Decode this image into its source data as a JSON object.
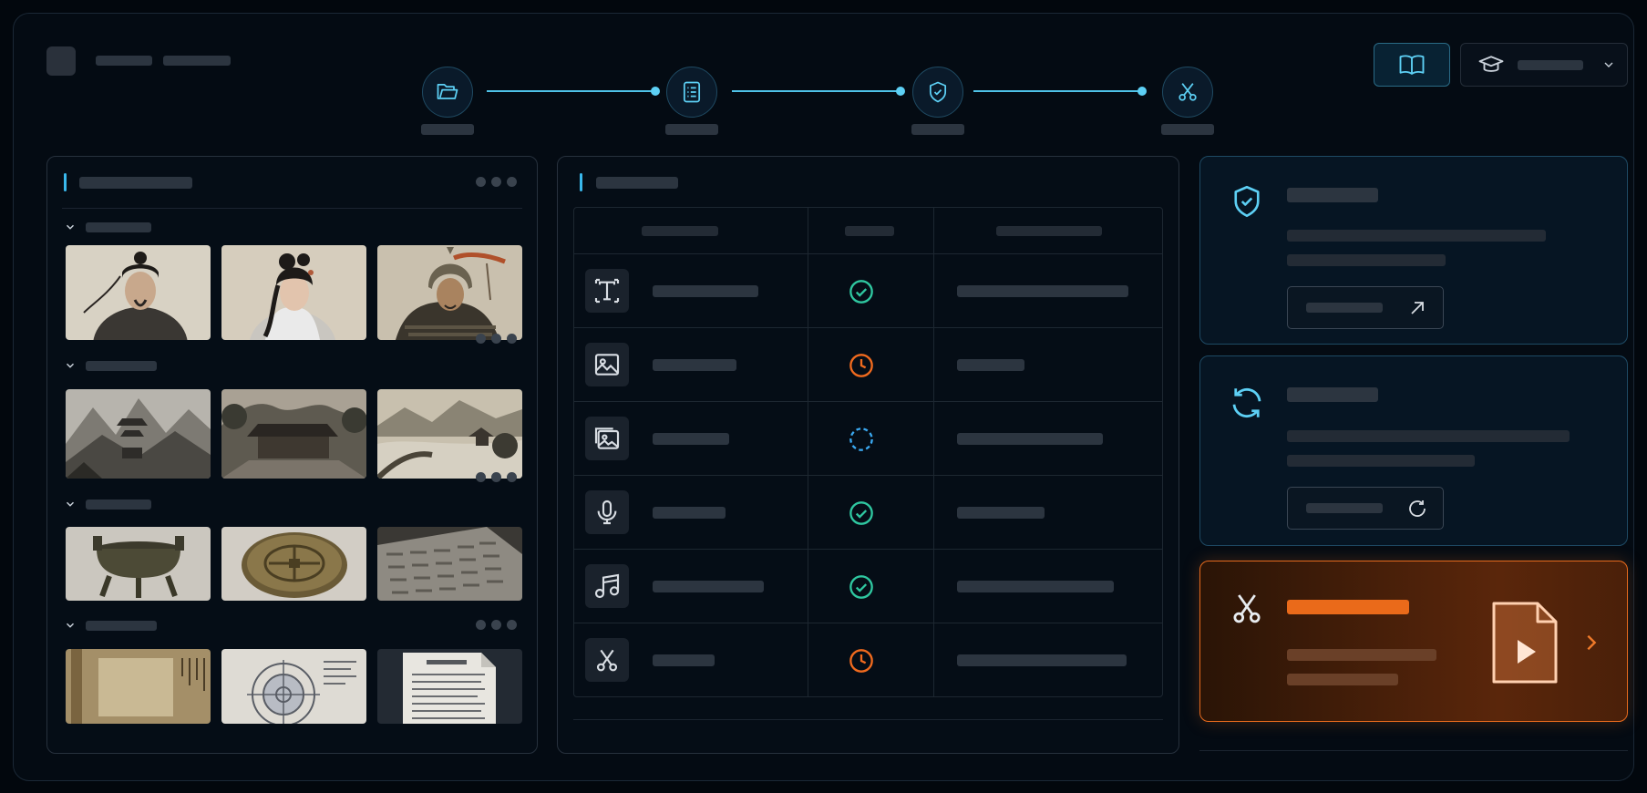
{
  "header": {
    "app_title": "",
    "nav_text_1": "",
    "nav_text_2": ""
  },
  "workflow": {
    "steps": [
      {
        "icon": "folder-open-icon",
        "label": ""
      },
      {
        "icon": "checklist-icon",
        "label": ""
      },
      {
        "icon": "shield-check-icon",
        "label": ""
      },
      {
        "icon": "scissors-icon",
        "label": ""
      }
    ]
  },
  "toolbar": {
    "library_icon": "book-open-icon",
    "profile_icon": "graduation-cap-icon",
    "profile_label": ""
  },
  "assets_panel": {
    "title": "",
    "groups": [
      {
        "label": "",
        "thumbnails": [
          "scholar-portrait",
          "lady-portrait",
          "warrior-portrait"
        ]
      },
      {
        "label": "",
        "thumbnails": [
          "mountain-temple",
          "courtyard-pavilion",
          "river-village"
        ]
      },
      {
        "label": "",
        "thumbnails": [
          "bronze-cauldron",
          "bronze-coin",
          "engraved-tablet"
        ]
      },
      {
        "label": "",
        "thumbnails": [
          "old-manuscript",
          "circular-diagram",
          "text-document"
        ]
      }
    ]
  },
  "task_panel": {
    "title": "",
    "columns": [
      "",
      "",
      ""
    ],
    "rows": [
      {
        "type_icon": "text-icon",
        "name": "",
        "status": "done",
        "detail": ""
      },
      {
        "type_icon": "image-icon",
        "name": "",
        "status": "pending",
        "detail": ""
      },
      {
        "type_icon": "images-icon",
        "name": "",
        "status": "in-progress",
        "detail": ""
      },
      {
        "type_icon": "microphone-icon",
        "name": "",
        "status": "done",
        "detail": ""
      },
      {
        "type_icon": "music-icon",
        "name": "",
        "status": "done",
        "detail": ""
      },
      {
        "type_icon": "scissors-icon",
        "name": "",
        "status": "pending",
        "detail": ""
      }
    ]
  },
  "cards": {
    "review": {
      "icon": "shield-check-icon",
      "title": "",
      "desc": "",
      "button": "",
      "button_icon": "arrow-up-right-icon"
    },
    "sync": {
      "icon": "refresh-icon",
      "title": "",
      "desc": "",
      "button": "",
      "button_icon": "refresh-icon"
    },
    "edit": {
      "icon": "scissors-icon",
      "title": "",
      "desc": "",
      "file_icon": "video-file-icon",
      "arrow_icon": "chevron-right-icon"
    }
  },
  "colors": {
    "accent_blue": "#4fc3e8",
    "accent_orange": "#e66a1d",
    "status_done": "#2fc7a0",
    "status_pending": "#f06a1e",
    "status_in_progress": "#3aa8f0"
  }
}
